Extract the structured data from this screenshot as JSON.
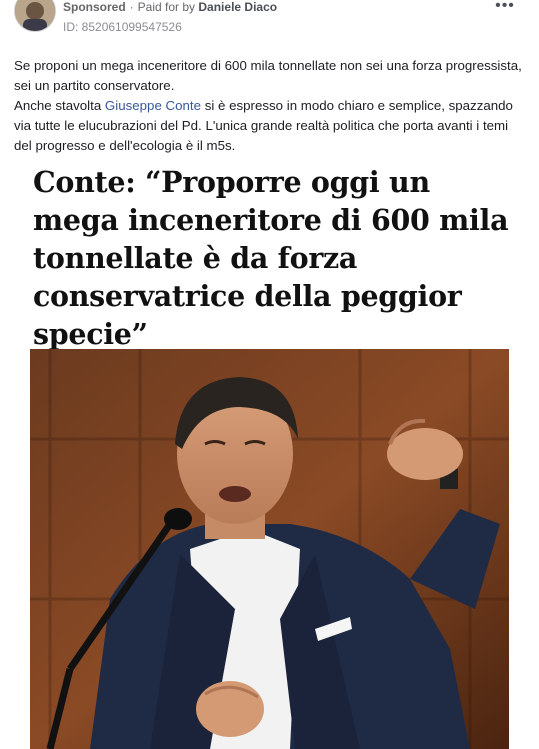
{
  "ad": {
    "sponsored_label": "Sponsored",
    "paid_for_prefix": "Paid for by",
    "advertiser": "Daniele Diaco",
    "ad_id": "ID: 852061099547526",
    "more_icon": "more-horizontal-icon"
  },
  "post": {
    "line1": "Se proponi un mega inceneritore di 600 mila tonnellate non sei una forza progressista, sei un partito conservatore.",
    "line2_before": "Anche stavolta ",
    "mention": "Giuseppe Conte",
    "line2_after": " si è espresso in modo chiaro e semplice, spazzando via tutte le elucubrazioni del Pd. L'unica grande realtà politica che porta avanti i temi del progresso e dell'ecologia è il m5s."
  },
  "media": {
    "headline": "Conte: “Proporre oggi un mega inceneritore di 600 mila tonnellate è da forza conservatrice della peggior specie”"
  },
  "colors": {
    "link": "#385898",
    "meta": "#65676b"
  }
}
